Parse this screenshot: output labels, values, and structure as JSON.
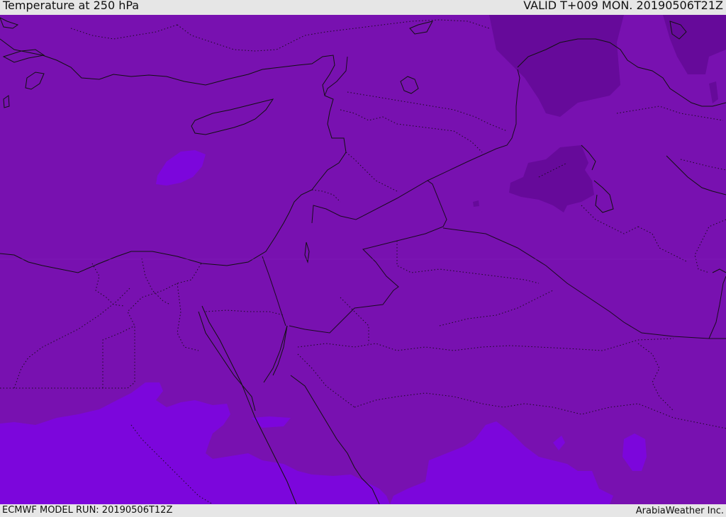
{
  "header": {
    "title": "Temperature at 250 hPa",
    "valid_time": "VALID T+009 MON. 20190506T21Z"
  },
  "footer": {
    "model_run": "ECMWF MODEL RUN: 20190506T12Z",
    "credit": "ArabiaWeather Inc."
  },
  "colors": {
    "base_field": "#7811b0",
    "cold_field": "#650a98",
    "warm_field": "#7a04da",
    "coastline": "#111111",
    "border": "#2a0a3a"
  }
}
